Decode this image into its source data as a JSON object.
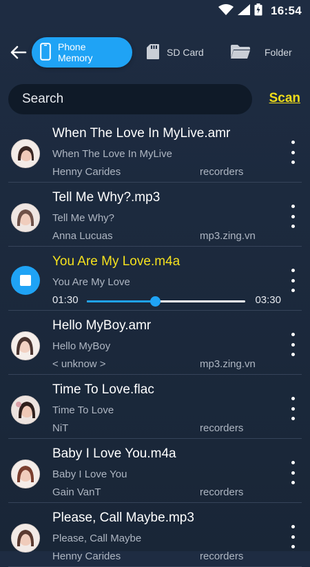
{
  "status": {
    "time": "16:54"
  },
  "tabs": [
    {
      "label": "Phone Memory",
      "icon": "phone-icon",
      "active": true
    },
    {
      "label": "SD Card",
      "icon": "sd-card-icon",
      "active": false
    },
    {
      "label": "Folder",
      "icon": "folder-icon",
      "active": false
    }
  ],
  "search": {
    "placeholder": "Search",
    "scan_label": "Scan"
  },
  "colors": {
    "accent": "#1fa3f5",
    "highlight": "#f5e11e",
    "background": "#1e2c42"
  },
  "recordings": [
    {
      "title": "When The Love In MyLive.amr",
      "subtitle": "When The Love In MyLive",
      "artist": "Henny Carides",
      "source": "recorders"
    },
    {
      "title": "Tell Me Why?.mp3",
      "subtitle": "Tell Me Why?",
      "artist": "Anna Lucuas",
      "source": "mp3.zing.vn"
    },
    {
      "title": "You Are My Love.m4a",
      "subtitle": "You Are My Love",
      "playing": true,
      "current_time": "01:30",
      "total_time": "03:30",
      "progress": 0.43
    },
    {
      "title": "Hello MyBoy.amr",
      "subtitle": "Hello MyBoy",
      "artist": "< unknow >",
      "source": "mp3.zing.vn"
    },
    {
      "title": "Time To Love.flac",
      "subtitle": "Time To Love",
      "artist": "NiT",
      "source": "recorders"
    },
    {
      "title": "Baby I Love You.m4a",
      "subtitle": "Baby I Love You",
      "artist": "Gain VanT",
      "source": "recorders"
    },
    {
      "title": "Please, Call Maybe.mp3",
      "subtitle": "Please, Call Maybe",
      "artist": "Henny Carides",
      "source": "recorders"
    }
  ]
}
